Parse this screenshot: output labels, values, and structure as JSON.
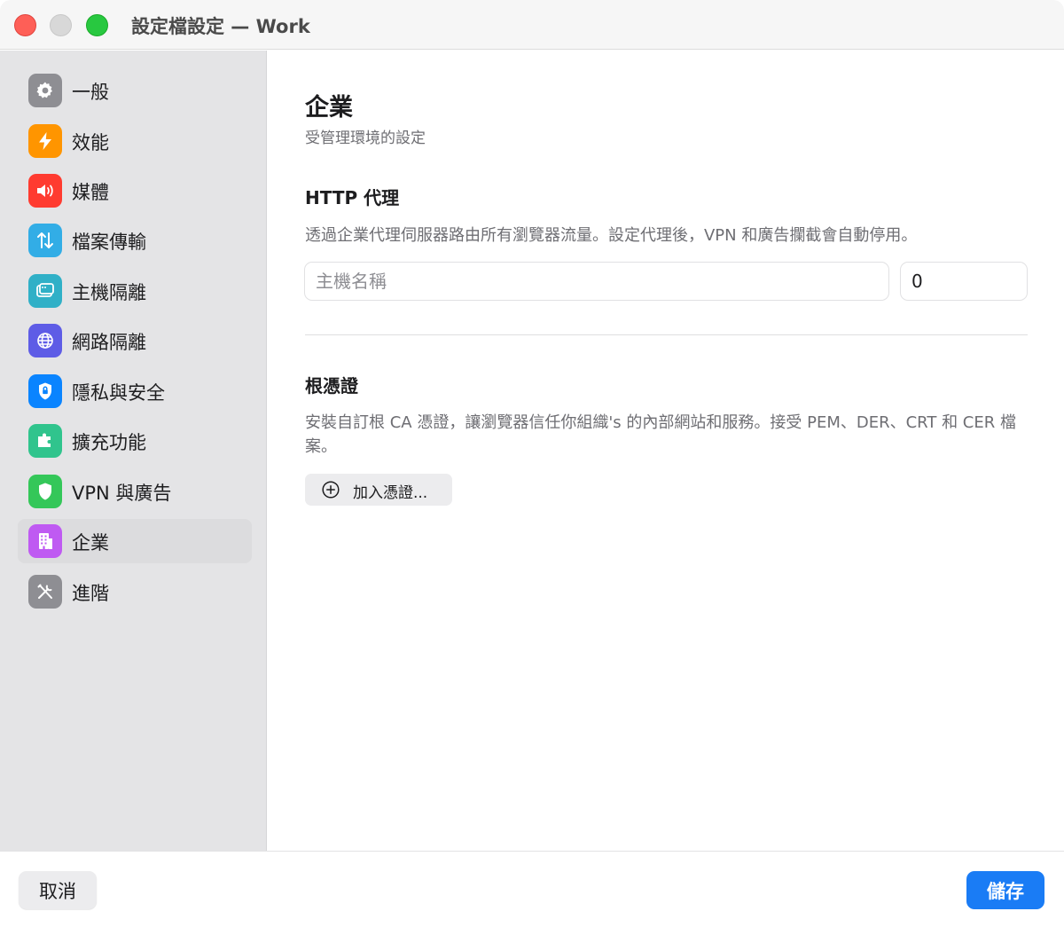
{
  "window": {
    "title": "設定檔設定 — Work"
  },
  "sidebar": {
    "items": [
      {
        "label": "一般",
        "icon": "gear-icon",
        "color": "#8e8e93"
      },
      {
        "label": "效能",
        "icon": "bolt-icon",
        "color": "#ff9500"
      },
      {
        "label": "媒體",
        "icon": "speaker-icon",
        "color": "#ff3b30"
      },
      {
        "label": "檔案傳輸",
        "icon": "arrows-updown-icon",
        "color": "#32ade6"
      },
      {
        "label": "主機隔離",
        "icon": "window-icon",
        "color": "#30b0c7"
      },
      {
        "label": "網路隔離",
        "icon": "globe-icon",
        "color": "#5e5ce6"
      },
      {
        "label": "隱私與安全",
        "icon": "lock-shield-icon",
        "color": "#0a84ff"
      },
      {
        "label": "擴充功能",
        "icon": "puzzle-icon",
        "color": "#30c48d"
      },
      {
        "label": "VPN 與廣告",
        "icon": "shield-icon",
        "color": "#34c759"
      },
      {
        "label": "企業",
        "icon": "building-icon",
        "color": "#bf5af2",
        "selected": true
      },
      {
        "label": "進階",
        "icon": "tools-icon",
        "color": "#8e8e93"
      }
    ]
  },
  "main": {
    "title": "企業",
    "subtitle": "受管理環境的設定",
    "proxy": {
      "title": "HTTP 代理",
      "description": "透過企業代理伺服器路由所有瀏覽器流量。設定代理後，VPN 和廣告攔截會自動停用。",
      "host_placeholder": "主機名稱",
      "host_value": "",
      "port_value": "0"
    },
    "certs": {
      "title": "根憑證",
      "description": "安裝自訂根 CA 憑證，讓瀏覽器信任你組織's 的內部網站和服務。接受 PEM、DER、CRT 和 CER 檔案。",
      "add_label": "加入憑證..."
    }
  },
  "footer": {
    "cancel_label": "取消",
    "save_label": "儲存"
  }
}
